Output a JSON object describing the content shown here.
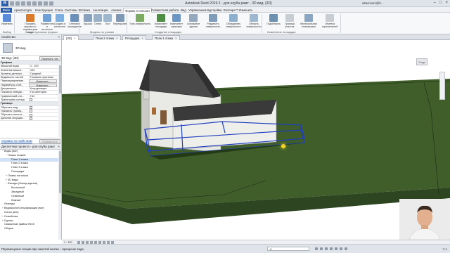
{
  "app": {
    "window_title": "Autodesk Revit 2019.2 - для клуба рамт - 3D вид: {3D}",
    "user": "ebarrowni@h...",
    "window_controls": [
      "–",
      "□",
      "×"
    ]
  },
  "ribbon_tabs": [
    "Файл",
    "Архитектура",
    "Конструкция",
    "Сталь",
    "Системы",
    "Вставка",
    "Аннотации",
    "Анализ",
    "Формы и генплан",
    "Совместная работа",
    "Вид",
    "Управление",
    "Надстройки",
    "Enscape™",
    "Изменить"
  ],
  "ribbon": {
    "buttons": [
      {
        "label": "Изменить",
        "color": "#5b8bd6"
      },
      {
        "label": "Показать формы по параметрам вида",
        "color": "#d97b2b"
      },
      {
        "label": "Разместить в контексте",
        "color": "#6f9fd4"
      },
      {
        "label": "Создать в контексте",
        "color": "#7db0e0"
      },
      {
        "label": "Стеновое ограждение",
        "color": "#6a8fb8"
      },
      {
        "label": "Крыша",
        "color": "#8aa2bf"
      },
      {
        "label": "Стена",
        "color": "#9ab0c8"
      },
      {
        "label": "Пол",
        "color": "#9fb6cf"
      },
      {
        "label": "Перекрытие",
        "color": "#7f98b5"
      },
      {
        "label": "Топо-поверхность",
        "color": "#7daa63"
      },
      {
        "label": "Компонент площадки",
        "color": "#4f8d44"
      },
      {
        "label": "Компонент парковки",
        "color": "#6c96c4"
      },
      {
        "label": "Основание здания",
        "color": "#95a8bd"
      },
      {
        "label": "Разделить поверхность",
        "color": "#7f9db8"
      },
      {
        "label": "Объединить поверхности",
        "color": "#8fb0cc"
      },
      {
        "label": "Область поверхности",
        "color": "#a0b8cf"
      },
      {
        "label": "Подобласть",
        "color": "#6d8fb0"
      },
      {
        "label": "Граница участка",
        "color": "#c8cdd3"
      },
      {
        "label": "Вертикальная планировка",
        "color": "#8aa6c2"
      },
      {
        "label": "Отметка горизонталей",
        "color": "#c8cdd3"
      }
    ],
    "groups": [
      "Выбор",
      "Концептуальные формы",
      "Модель по граням",
      "Создание площадки",
      "Изменение площадки"
    ]
  },
  "properties": {
    "title": "Свойства",
    "type_name": "3D вид",
    "selector": "3D вид: {3D}",
    "edit_type": "Изменить тип",
    "rows": [
      {
        "cat": "Графика"
      },
      {
        "k": "Масштаб вида",
        "v": "1 : 100"
      },
      {
        "k": "Значение масшт...",
        "v": "100"
      },
      {
        "k": "Уровень детализ...",
        "v": "Средний"
      },
      {
        "k": "Видимость частей",
        "v": "Показать оригинал"
      },
      {
        "k": "Переопределения...",
        "v": "Изменить...",
        "btn": true
      },
      {
        "k": "Параметры отоб...",
        "v": "Изменить...",
        "btn": true
      },
      {
        "k": "Дисциплина",
        "v": "Координация"
      },
      {
        "k": "Показать невиди...",
        "v": "По категории"
      },
      {
        "k": "Графический сти...",
        "v": "Нет"
      },
      {
        "k": "Траектория солнца",
        "chk": true
      },
      {
        "cat": "Границы"
      },
      {
        "k": "Обрезать вид",
        "chk": true
      },
      {
        "k": "Показать границ...",
        "chk": true
      },
      {
        "k": "Обрезать аннота...",
        "chk": true
      },
      {
        "k": "Дальняя секущая...",
        "chk": true
      }
    ],
    "help": "Справка по свойствам",
    "apply": "Применить"
  },
  "browser": {
    "title": "Диспетчер проекта - для клуба рамт",
    "items": [
      {
        "label": "Виды (все)",
        "level": 0,
        "toggle": "−"
      },
      {
        "label": "Планы этажей",
        "level": 1,
        "toggle": "−"
      },
      {
        "label": "План 1 этажа",
        "level": 2,
        "toggle": "",
        "selected": true
      },
      {
        "label": "План 2 этажа",
        "level": 2,
        "toggle": ""
      },
      {
        "label": "План 3 этажа",
        "level": 2,
        "toggle": ""
      },
      {
        "label": "Площадка",
        "level": 2,
        "toggle": ""
      },
      {
        "label": "Планы потолков",
        "level": 1,
        "toggle": "+"
      },
      {
        "label": "3D виды",
        "level": 1,
        "toggle": "+"
      },
      {
        "label": "Фасады (Фасад здания)",
        "level": 1,
        "toggle": "−"
      },
      {
        "label": "Восточный",
        "level": 2,
        "toggle": ""
      },
      {
        "label": "Западный",
        "level": 2,
        "toggle": ""
      },
      {
        "label": "Северный",
        "level": 2,
        "toggle": ""
      },
      {
        "label": "Южный",
        "level": 2,
        "toggle": ""
      },
      {
        "label": "Легенды",
        "level": 0,
        "toggle": ""
      },
      {
        "label": "Ведомости/Спецификации (все)",
        "level": 0,
        "toggle": "+"
      },
      {
        "label": "Листы (все)",
        "level": 0,
        "toggle": ""
      },
      {
        "label": "Семейства",
        "level": 0,
        "toggle": "+"
      },
      {
        "label": "Группы",
        "level": 0,
        "toggle": "+"
      },
      {
        "label": "Связанные файлы Revit",
        "level": 0,
        "toggle": ""
      },
      {
        "label": "Сборки",
        "level": 0,
        "toggle": ""
      }
    ]
  },
  "view_tabs": [
    "{3D}",
    "План 2 этажа",
    "Площадка",
    "План 1 этажа"
  ],
  "viewport": {
    "viewcube_label": "Сзади",
    "colors": {
      "ground": "#3f5e2a",
      "roof": "#3c3c3c",
      "wall": "#e8e8e4",
      "selection": "#1f3fbf"
    }
  },
  "view_control": {
    "scale": "1 : 100"
  },
  "status": {
    "message": "Перемещение секции при нажатой кнопке – вращение вида.",
    "workset": ":0",
    "filter_count": "0"
  }
}
